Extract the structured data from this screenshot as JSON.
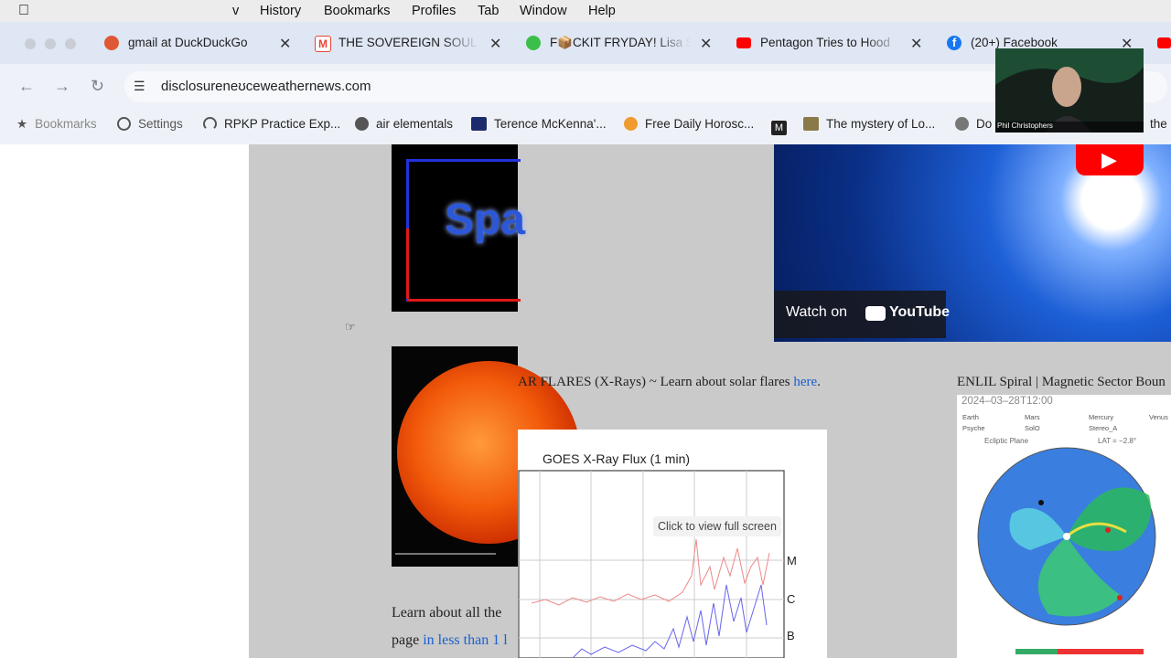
{
  "menu_bar": {
    "items": [
      "v",
      "History",
      "Bookmarks",
      "Profiles",
      "Tab",
      "Window",
      "Help"
    ]
  },
  "tabs": [
    {
      "title": "gmail at DuckDuckGo",
      "color": "#de5833"
    },
    {
      "title": "THE SOVEREIGN SOUL",
      "color": "#ea4335"
    },
    {
      "title": "F📦CKIT FRYDAY! Lisa S",
      "color": "#3cbf4a"
    },
    {
      "title": "Pentagon Tries to Hood",
      "color": "#ff0000"
    },
    {
      "title": "(20+) Facebook",
      "color": "#1877f2"
    }
  ],
  "address_bar": {
    "url": "disclosureneʊceweathernews.com"
  },
  "bookmarks": [
    "Bookmarks",
    "Settings",
    "RPKP Practice Exp...",
    "air elementals",
    "Terence McKenna'...",
    "Free Daily Horosc...",
    "",
    "The mystery of Lo...",
    "Do",
    "the"
  ],
  "webcam": {
    "name": "Phil Christophers"
  },
  "page": {
    "logo_text": "Spa",
    "video_watch": "Watch on",
    "video_brand": "YouTube",
    "flares_text": "AR FLARES (X-Rays) ~ Learn about solar flares ",
    "flares_link": "here",
    "flares_tail": ".",
    "enlil_title": "ENLIL Spiral | Magnetic Sector Boun",
    "enlil_time": "2024–03–28T12:00",
    "enlil_legend": [
      "Earth",
      "Mars",
      "Mercury",
      "Venus",
      "Psyche",
      "SolO",
      "Stereo_A"
    ],
    "enlil_plane": "Ecliptic Plane",
    "enlil_lat": "LAT = −2.8°",
    "goes_title": "GOES X-Ray Flux (1 min)",
    "goes_overlay": "Click to view full screen",
    "goes_classes": [
      "M",
      "C",
      "B"
    ],
    "learn_line1": "Learn about all the",
    "learn_line2_prefix": "page ",
    "learn_line2_link": "in less than 1 l"
  }
}
